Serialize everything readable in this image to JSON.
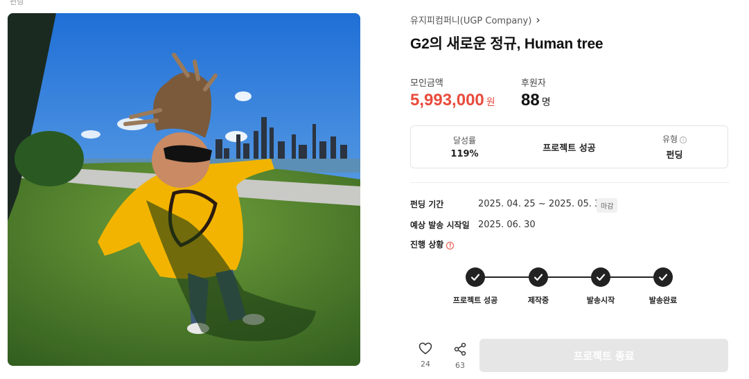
{
  "breadcrumb": "펀딩",
  "creator": {
    "name": "유지피컴퍼니(UGP Company)"
  },
  "title": "G2의 새로운 정규, Human tree",
  "stats": {
    "amount_label": "모인금액",
    "amount_value": "5,993,000",
    "amount_unit": "원",
    "backers_label": "후원자",
    "backers_value": "88",
    "backers_unit": "명"
  },
  "summary": {
    "rate_label": "달성률",
    "rate_value": "119%",
    "status_value": "프로젝트 성공",
    "type_label": "유형",
    "type_value": "펀딩"
  },
  "details": {
    "period_label": "펀딩 기간",
    "period_value": "2025. 04. 25 ~ 2025. 05. 31",
    "period_badge": "마감",
    "ship_label": "예상 발송 시작일",
    "ship_value": "2025. 06. 30",
    "progress_label": "진행 상황"
  },
  "steps": [
    {
      "label": "프로젝트 성공",
      "done": true
    },
    {
      "label": "제작중",
      "done": true
    },
    {
      "label": "발송시작",
      "done": true
    },
    {
      "label": "발송완료",
      "done": true
    }
  ],
  "actions": {
    "like_count": "24",
    "share_count": "63",
    "end_button_label": "프로젝트 종료"
  },
  "colors": {
    "accent": "#e84b3c",
    "step_done": "#222222",
    "disabled_button": "#e6e6e6"
  }
}
